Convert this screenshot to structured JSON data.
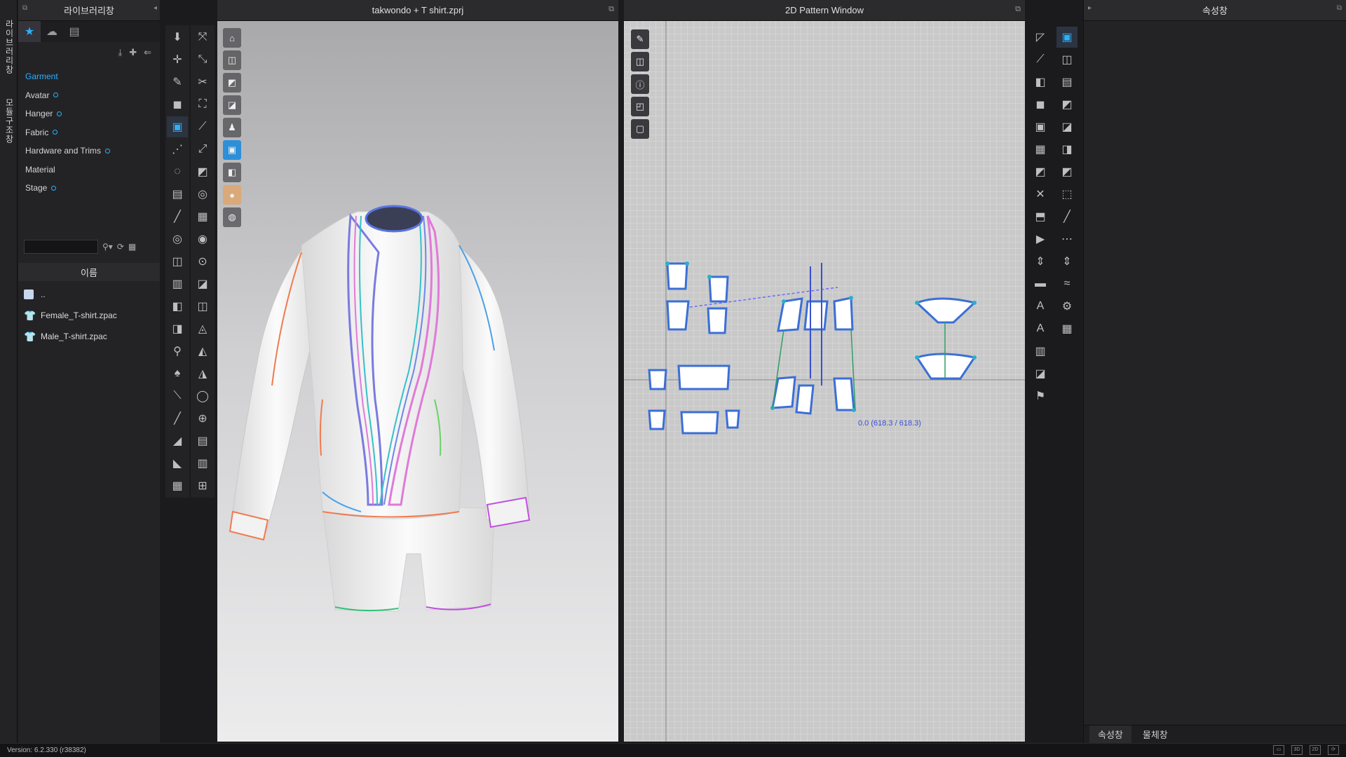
{
  "left_strip": {
    "tab1": "라이브러리창",
    "tab2": "모듈구조창"
  },
  "library": {
    "title": "라이브러리창",
    "tabs": [
      {
        "icon": "star-icon",
        "glyph": "★"
      },
      {
        "icon": "cloud-icon",
        "glyph": "☁"
      },
      {
        "icon": "clipboard-icon",
        "glyph": "▤"
      }
    ],
    "categories": [
      {
        "label": "Garment",
        "dot": false,
        "active": true
      },
      {
        "label": "Avatar",
        "dot": true
      },
      {
        "label": "Hanger",
        "dot": true
      },
      {
        "label": "Fabric",
        "dot": true
      },
      {
        "label": "Hardware and Trims",
        "dot": true
      },
      {
        "label": "Material",
        "dot": false
      },
      {
        "label": "Stage",
        "dot": true
      }
    ],
    "search_placeholder": "",
    "name_header": "이름",
    "files": [
      {
        "name": "..",
        "type": "folder"
      },
      {
        "name": "Female_T-shirt.zpac",
        "type": "garment"
      },
      {
        "name": "Male_T-shirt.zpac",
        "type": "garment"
      }
    ]
  },
  "window3d": {
    "title": "takwondo + T shirt.zprj"
  },
  "window2d": {
    "title": "2D Pattern Window",
    "readout": "0.0 (618.3 / 618.3)"
  },
  "properties": {
    "title": "속성창",
    "bottom_tabs": [
      "속성창",
      "물체창"
    ]
  },
  "status": {
    "version": "Version: 6.2.330 (r38382)"
  },
  "colors": {
    "accent": "#2ab0ff",
    "panel": "#232326",
    "pattern_outline": "#3b6fd6"
  }
}
